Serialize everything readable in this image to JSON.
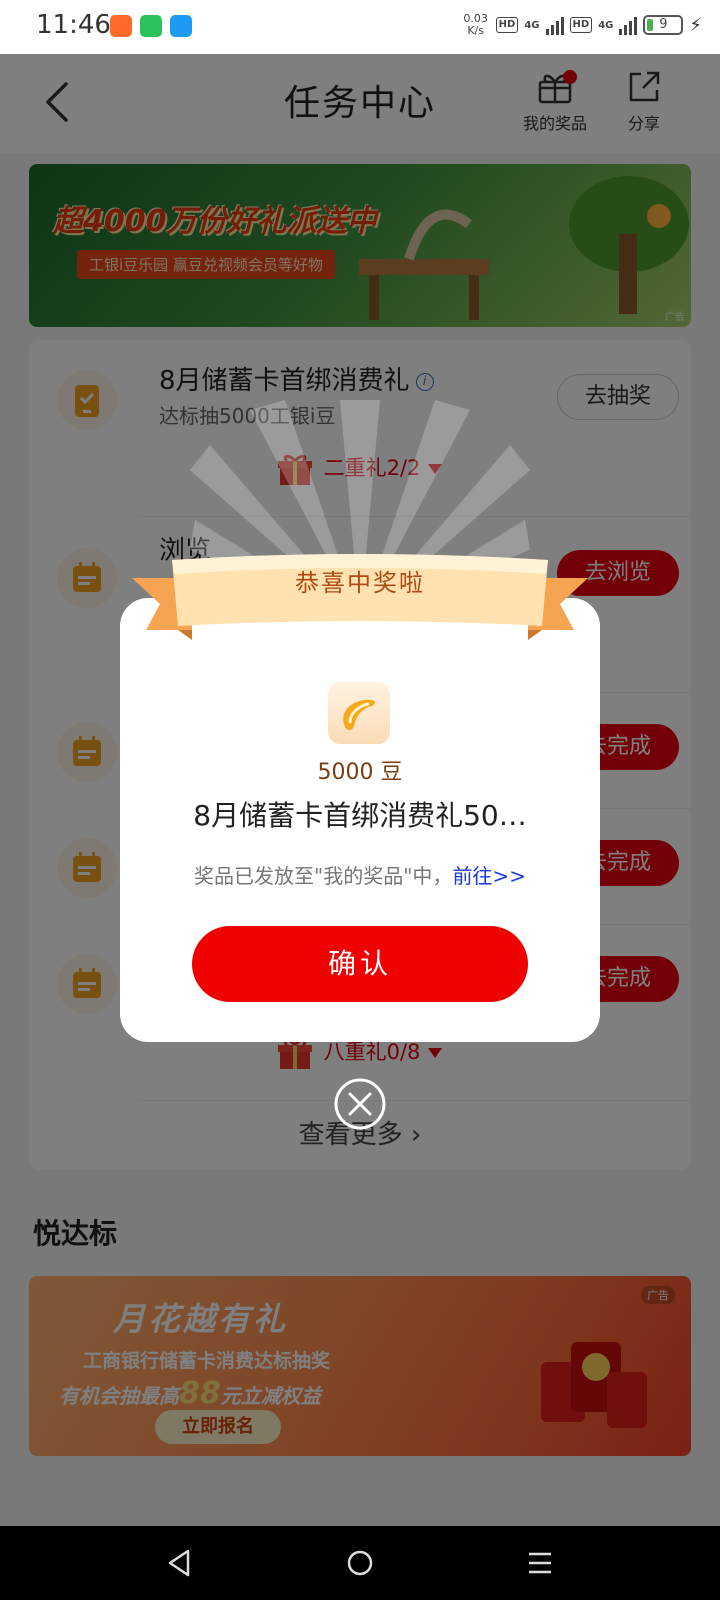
{
  "status_bar": {
    "time": "11:46",
    "net_speed_value": "0.03",
    "net_speed_unit": "K/s",
    "hd_label": "HD",
    "net_type": "4G",
    "battery_level": "9",
    "app_icon_colors": [
      "#ff6a2a",
      "#2bc15b",
      "#1e9bf0"
    ]
  },
  "header": {
    "title": "任务中心",
    "my_prizes_label": "我的奖品",
    "share_label": "分享",
    "icons": [
      "back-icon",
      "gift-icon",
      "share-icon"
    ]
  },
  "banner_top": {
    "headline": "超4000万份好礼派送中",
    "subline": "工银i豆乐园 赢豆兑视频会员等好物",
    "ad_tag": "广告"
  },
  "tasks": {
    "item1": {
      "title": "8月储蓄卡首绑消费礼",
      "desc": "达标抽5000工银i豆",
      "button": "去抽奖",
      "gift": "二重礼2/2"
    },
    "item2": {
      "title_partial": "浏览",
      "button": "去浏览"
    },
    "item3": {
      "button": "去完成"
    },
    "item4": {
      "button": "去完成"
    },
    "item5": {
      "button": "去完成",
      "gift": "八重礼0/8"
    },
    "see_more": "查看更多"
  },
  "section": {
    "title": "悦达标"
  },
  "banner_bottom": {
    "title": "月花越有礼",
    "line1": "工商银行储蓄卡消费达标抽奖",
    "line2_prefix": "有机会抽最高",
    "line2_amount": "88",
    "line2_suffix": "元立减权益",
    "button": "立即报名",
    "ad_tag": "广告"
  },
  "dialog": {
    "ribbon_title": "恭喜中奖啦",
    "prize_amount": "5000 豆",
    "prize_name": "8月储蓄卡首绑消费礼50…",
    "note": "奖品已发放至\"我的奖品\"中，",
    "note_link": "前往>>",
    "confirm": "确认",
    "icons": [
      "bean-icon",
      "close-circle-icon"
    ]
  },
  "colors": {
    "accent_red": "#e60012",
    "confirm_red": "#f00000",
    "link_blue": "#1a3ad8",
    "ribbon_orange": "#f6b56b"
  }
}
